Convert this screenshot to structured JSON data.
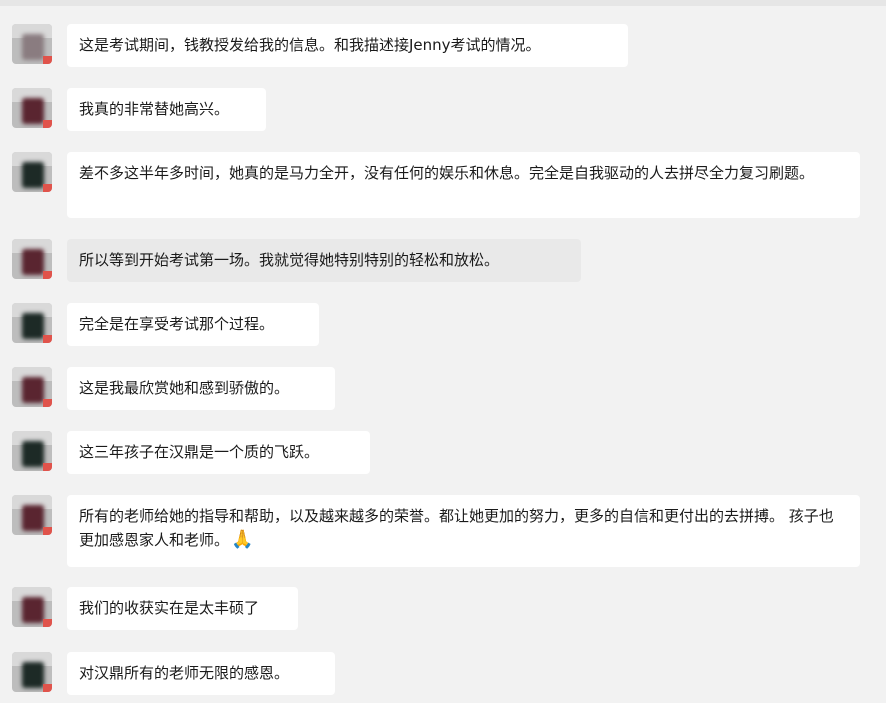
{
  "messages": [
    {
      "text": "这是考试期间，钱教授发给我的信息。和我描述接Jenny考试的情况。"
    },
    {
      "text": "我真的非常替她高兴。"
    },
    {
      "text": "差不多这半年多时间，她真的是马力全开，没有任何的娱乐和休息。完全是自我驱动的人去拼尽全力复习刷题。"
    },
    {
      "text": "所以等到开始考试第一场。我就觉得她特别特别的轻松和放松。"
    },
    {
      "text": "完全是在享受考试那个过程。"
    },
    {
      "text": "这是我最欣赏她和感到骄傲的。"
    },
    {
      "text": "这三年孩子在汉鼎是一个质的飞跃。"
    },
    {
      "text": "所有的老师给她的指导和帮助，以及越来越多的荣誉。都让她更加的努力，更多的自信和更付出的去拼搏。 孩子也更加感恩家人和老师。",
      "emoji": "🙏"
    },
    {
      "text": "我们的收获实在是太丰硕了"
    },
    {
      "text": "对汉鼎所有的老师无限的感恩。"
    }
  ],
  "colors": {
    "background": "#f2f2f2",
    "bubble": "#ffffff",
    "bubble_highlight": "#e9e9e9",
    "avatar_badge": "#e0534b"
  }
}
